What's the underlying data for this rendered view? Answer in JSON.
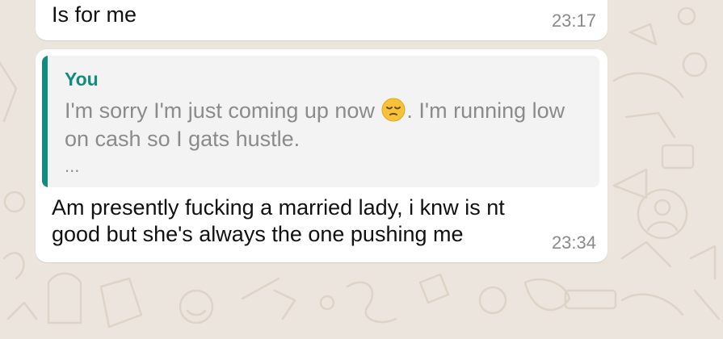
{
  "colors": {
    "chat_background": "#ece5dd",
    "bubble_background": "#ffffff",
    "quote_background": "#f3f3f3",
    "quote_accent": "#128c7e",
    "timestamp_text": "#8a8a8a"
  },
  "messages": [
    {
      "text": "Is for me",
      "time": "23:17"
    },
    {
      "text": "Am presently fucking a married lady, i knw is nt good but she's always the one pushing me",
      "time": "23:34",
      "quote": {
        "author": "You",
        "text_before_emoji": "I'm sorry I'm just coming up now ",
        "emoji": "pensive-face-emoji",
        "text_after_emoji": ". I'm running low on cash so I gats hustle.",
        "more": "..."
      }
    }
  ]
}
